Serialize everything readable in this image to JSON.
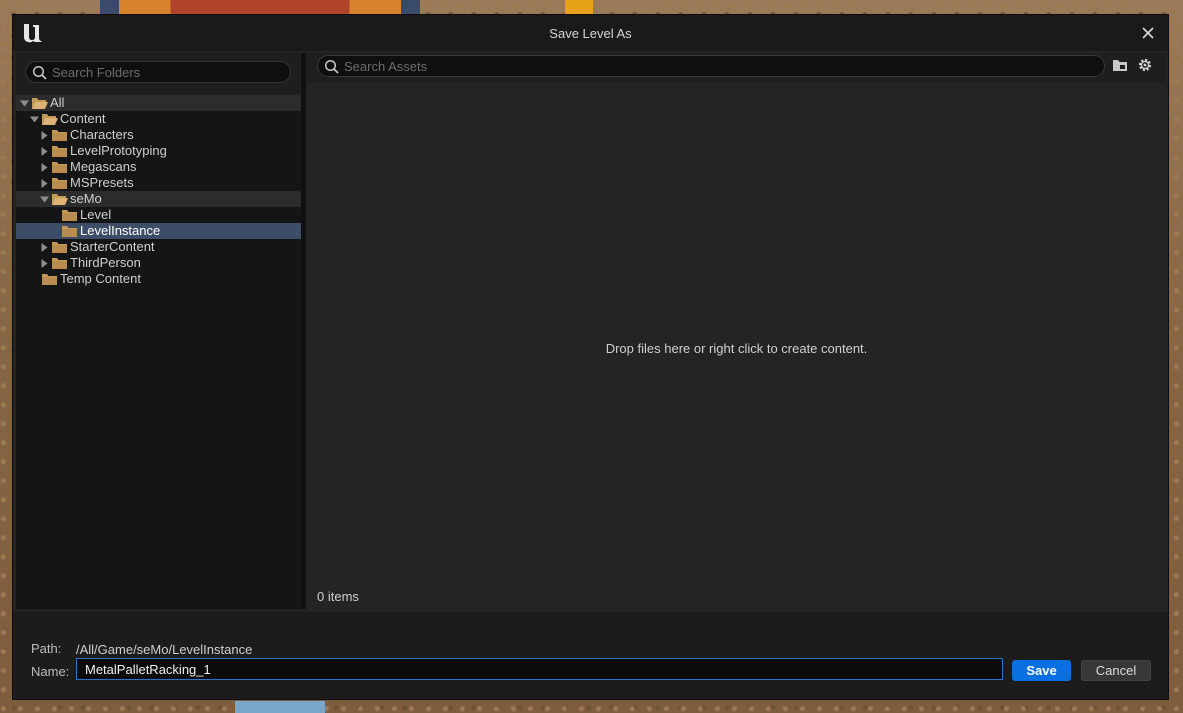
{
  "window": {
    "title": "Save Level As"
  },
  "folders": {
    "search_placeholder": "Search Folders",
    "tree": [
      {
        "label": "All",
        "depth": 0,
        "expanded": true,
        "has_children": true,
        "state": "highlight"
      },
      {
        "label": "Content",
        "depth": 1,
        "expanded": true,
        "has_children": true,
        "state": "none"
      },
      {
        "label": "Characters",
        "depth": 2,
        "expanded": false,
        "has_children": true,
        "state": "none"
      },
      {
        "label": "LevelPrototyping",
        "depth": 2,
        "expanded": false,
        "has_children": true,
        "state": "none"
      },
      {
        "label": "Megascans",
        "depth": 2,
        "expanded": false,
        "has_children": true,
        "state": "none"
      },
      {
        "label": "MSPresets",
        "depth": 2,
        "expanded": false,
        "has_children": true,
        "state": "none"
      },
      {
        "label": "seMo",
        "depth": 2,
        "expanded": true,
        "has_children": true,
        "state": "highlight"
      },
      {
        "label": "Level",
        "depth": 3,
        "expanded": false,
        "has_children": false,
        "state": "none"
      },
      {
        "label": "LevelInstance",
        "depth": 3,
        "expanded": false,
        "has_children": false,
        "state": "selected"
      },
      {
        "label": "StarterContent",
        "depth": 2,
        "expanded": false,
        "has_children": true,
        "state": "none"
      },
      {
        "label": "ThirdPerson",
        "depth": 2,
        "expanded": false,
        "has_children": true,
        "state": "none"
      },
      {
        "label": "Temp Content",
        "depth": 1,
        "expanded": false,
        "has_children": false,
        "state": "none"
      }
    ]
  },
  "assets": {
    "search_placeholder": "Search Assets",
    "empty_message": "Drop files here or right click to create content.",
    "items_count": "0 items"
  },
  "footer": {
    "path_label": "Path:",
    "path_value": "/All/Game/seMo/LevelInstance",
    "name_label": "Name:",
    "name_value": "MetalPalletRacking_1",
    "save_label": "Save",
    "cancel_label": "Cancel"
  },
  "colors": {
    "folder": "#c49a5a",
    "selection": "#3d4d67",
    "primary_button": "#0a6fe0",
    "input_focus": "#2b73c5"
  }
}
